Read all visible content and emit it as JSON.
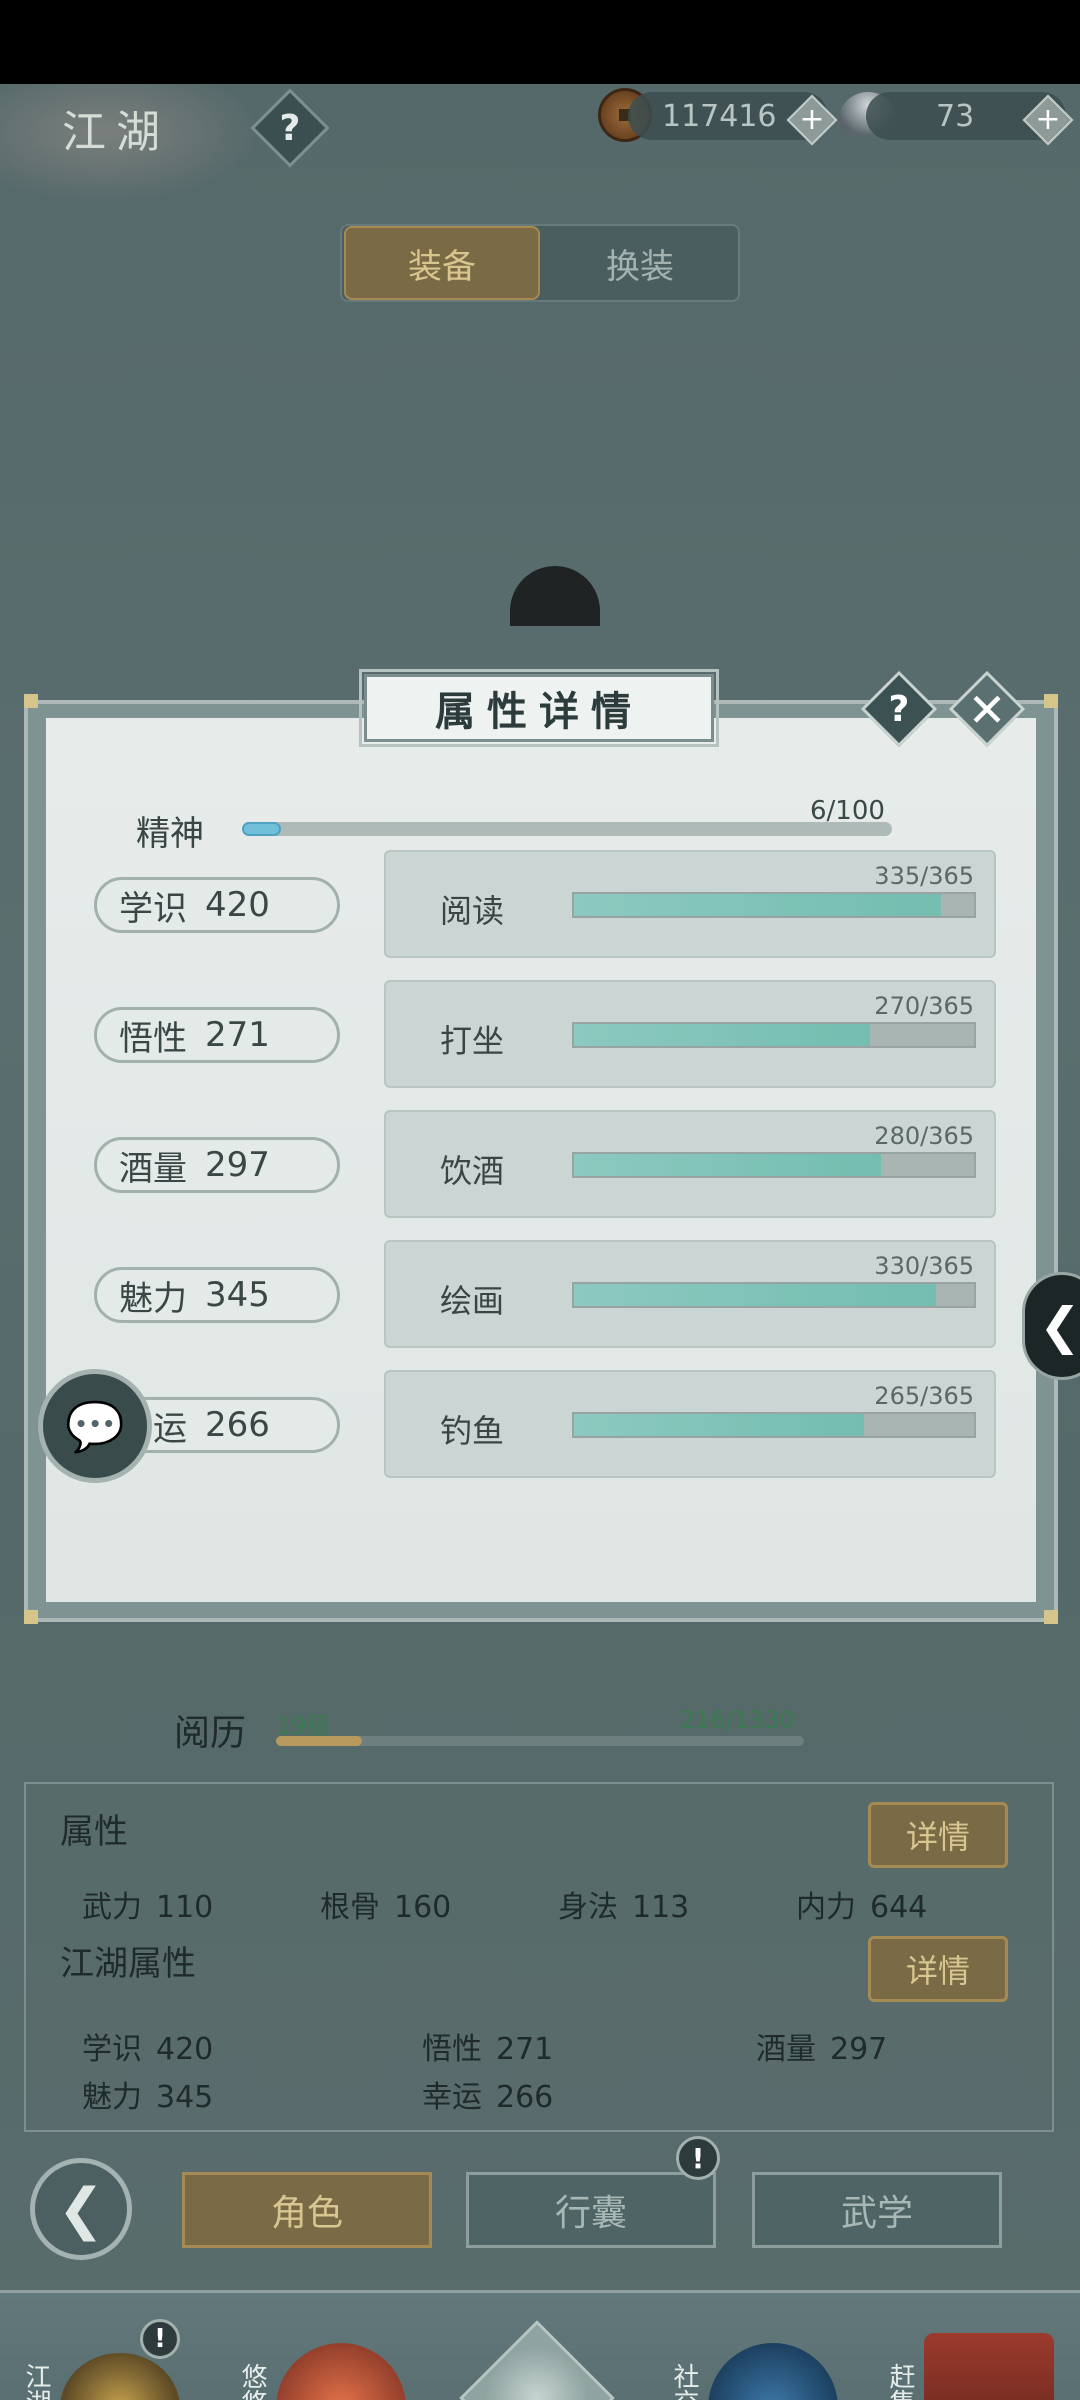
{
  "header": {
    "title": "江湖",
    "help_icon": "question-icon",
    "coins": "117416",
    "silver": "73",
    "plus": "+"
  },
  "tabs": {
    "equip": "装备",
    "outfit": "换装"
  },
  "modal": {
    "title": "属性详情",
    "help": "?",
    "close": "✕",
    "spirit": {
      "label": "精神",
      "value_text": "6/100",
      "fraction": 0.06
    },
    "rows": [
      {
        "stat": "学识",
        "stat_value": "420",
        "skill": "阅读",
        "progress_text": "335/365",
        "fraction": 0.918
      },
      {
        "stat": "悟性",
        "stat_value": "271",
        "skill": "打坐",
        "progress_text": "270/365",
        "fraction": 0.74
      },
      {
        "stat": "酒量",
        "stat_value": "297",
        "skill": "饮酒",
        "progress_text": "280/365",
        "fraction": 0.767
      },
      {
        "stat": "魅力",
        "stat_value": "345",
        "skill": "绘画",
        "progress_text": "330/365",
        "fraction": 0.904
      },
      {
        "stat": "幸运",
        "stat_value": "266",
        "skill": "钓鱼",
        "progress_text": "265/365",
        "fraction": 0.726
      }
    ]
  },
  "experience": {
    "label": "阅历",
    "level": "19级",
    "value_text": "216/1330",
    "fraction": 0.162
  },
  "attributes": {
    "heading": "属性",
    "detail": "详情",
    "items": [
      {
        "name": "武力",
        "value": "110"
      },
      {
        "name": "根骨",
        "value": "160"
      },
      {
        "name": "身法",
        "value": "113"
      },
      {
        "name": "内力",
        "value": "644"
      }
    ]
  },
  "jianghu_attributes": {
    "heading": "江湖属性",
    "detail": "详情",
    "items": [
      {
        "name": "学识",
        "value": "420"
      },
      {
        "name": "悟性",
        "value": "271"
      },
      {
        "name": "酒量",
        "value": "297"
      },
      {
        "name": "魅力",
        "value": "345"
      },
      {
        "name": "幸运",
        "value": "266"
      }
    ]
  },
  "actions": {
    "back": "❮",
    "role": "角色",
    "bag": "行囊",
    "martial": "武学",
    "notice": "!"
  },
  "bottom_nav": [
    {
      "label": "江湖"
    },
    {
      "label": "悠悠"
    },
    {
      "label": ""
    },
    {
      "label": "社交"
    },
    {
      "label": "赶集"
    }
  ],
  "colors": {
    "accent_gold": "#7a6a45",
    "progress_teal": "#74bdb0",
    "spirit_blue": "#6fc0d8"
  }
}
